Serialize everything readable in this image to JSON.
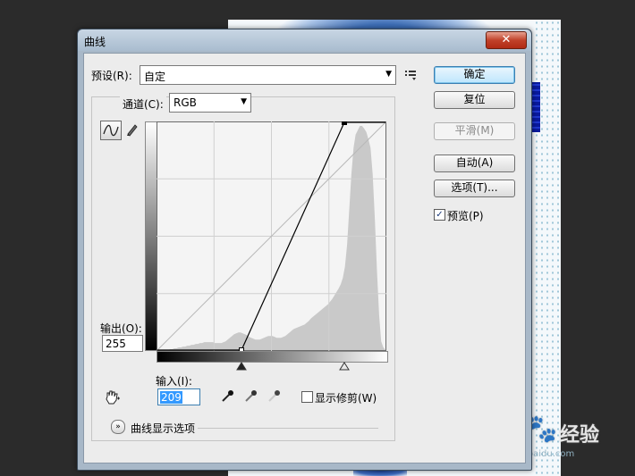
{
  "dialog": {
    "title": "曲线",
    "close_icon": "✕"
  },
  "preset": {
    "label": "预设(R):",
    "value": "自定"
  },
  "channel": {
    "label": "通道(C):",
    "value": "RGB"
  },
  "output": {
    "label": "输出(O):",
    "value": "255"
  },
  "input": {
    "label": "输入(I):",
    "value": "209"
  },
  "buttons": {
    "ok": "确定",
    "reset": "复位",
    "smooth": "平滑(M)",
    "auto": "自动(A)",
    "options": "选项(T)..."
  },
  "preview": {
    "label": "预览(P)",
    "checked": true
  },
  "show_clipping": {
    "label": "显示修剪(W)",
    "checked": false
  },
  "curve_display_options": {
    "label": "曲线显示选项"
  },
  "icons": {
    "curve_tool": "curve-icon",
    "pencil_tool": "pencil-icon",
    "preset_menu": "menu-icon",
    "hand_tool": "hand-icon",
    "black_eyedropper": "eyedropper-black-icon",
    "gray_eyedropper": "eyedropper-gray-icon",
    "white_eyedropper": "eyedropper-white-icon",
    "expand": "chevron-down-icon"
  },
  "colors": {
    "default_button": "#bee6fd",
    "histogram": "#c9c9c9",
    "titlebar": "#a9bccf"
  },
  "curve": {
    "points": [
      [
        0,
        0
      ],
      [
        94,
        0
      ],
      [
        209,
        255
      ],
      [
        255,
        255
      ]
    ],
    "black_point_input": 94,
    "white_point_input": 209
  },
  "histogram_levels": [
    0,
    0,
    0,
    0,
    0,
    0,
    1,
    1,
    2,
    2,
    3,
    3,
    4,
    4,
    5,
    5,
    6,
    6,
    7,
    7,
    8,
    8,
    9,
    9,
    9,
    9,
    9,
    8,
    8,
    8,
    8,
    9,
    10,
    12,
    14,
    16,
    18,
    19,
    20,
    20,
    19,
    18,
    17,
    15,
    14,
    13,
    12,
    12,
    12,
    13,
    14,
    15,
    16,
    16,
    16,
    15,
    14,
    14,
    14,
    15,
    16,
    18,
    20,
    22,
    24,
    25,
    26,
    27,
    28,
    29,
    31,
    33,
    36,
    38,
    40,
    42,
    44,
    46,
    48,
    50,
    52,
    55,
    58,
    62,
    66,
    70,
    75,
    82,
    95,
    120,
    160,
    200,
    230,
    245,
    250,
    255,
    255,
    252,
    248,
    240,
    230,
    200,
    150,
    90,
    40,
    10,
    3,
    0
  ]
}
